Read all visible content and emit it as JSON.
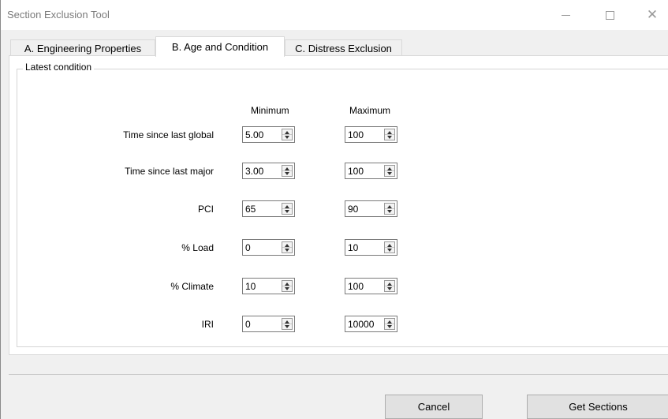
{
  "window": {
    "title": "Section Exclusion Tool"
  },
  "tabs": [
    {
      "label": "A. Engineering Properties",
      "active": false
    },
    {
      "label": "B. Age and Condition",
      "active": true
    },
    {
      "label": "C. Distress Exclusion",
      "active": false
    }
  ],
  "group": {
    "title": "Latest condition"
  },
  "columns": {
    "minimum": "Minimum",
    "maximum": "Maximum"
  },
  "rows": [
    {
      "label": "Time since last global",
      "min": "5.00",
      "max": "100"
    },
    {
      "label": "Time since last major",
      "min": "3.00",
      "max": "100"
    },
    {
      "label": "PCI",
      "min": "65",
      "max": "90"
    },
    {
      "label": "% Load",
      "min": "0",
      "max": "10"
    },
    {
      "label": "% Climate",
      "min": "10",
      "max": "100"
    },
    {
      "label": "IRI",
      "min": "0",
      "max": "10000"
    }
  ],
  "buttons": {
    "cancel": "Cancel",
    "get_sections": "Get Sections"
  },
  "icons": {
    "minimize": "minimize-icon",
    "maximize": "maximize-icon",
    "close": "close-icon",
    "spinner": "spinner-arrows-icon"
  }
}
